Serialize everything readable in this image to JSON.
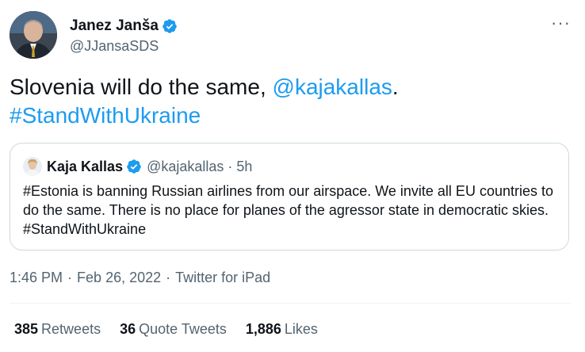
{
  "author": {
    "name": "Janez Janša",
    "handle": "@JJansaSDS",
    "verified": true,
    "avatar_icon": "person-avatar",
    "more_icon": "···"
  },
  "tweet": {
    "text_before": "Slovenia will do the same, ",
    "mention": "@kajakallas",
    "text_after": ".",
    "hashtag": "#StandWithUkraine"
  },
  "quoted": {
    "name": "Kaja Kallas",
    "handle": "@kajakallas",
    "dot": "·",
    "time": "5h",
    "verified": true,
    "text": "#Estonia is banning Russian airlines from our airspace. We invite all EU countries to do the same. There is no place for planes of the agressor state in democratic skies. #StandWithUkraine"
  },
  "meta": {
    "time": "1:46 PM",
    "sep1": "·",
    "date": "Feb 26, 2022",
    "sep2": "·",
    "source": "Twitter for iPad"
  },
  "stats": {
    "retweets_count": "385",
    "retweets_label": "Retweets",
    "quotes_count": "36",
    "quotes_label": "Quote Tweets",
    "likes_count": "1,886",
    "likes_label": "Likes"
  },
  "colors": {
    "link": "#1d9bf0",
    "muted": "#536471",
    "text": "#0f1419",
    "border": "#cfd9de"
  }
}
